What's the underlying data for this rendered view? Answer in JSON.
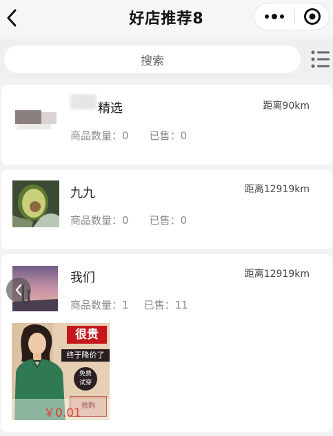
{
  "header": {
    "title": "好店推荐8"
  },
  "search": {
    "placeholder": "搜索"
  },
  "shops": [
    {
      "name": "精选",
      "distance": "距离90km",
      "goods_label": "商品数量：",
      "goods_count": "0",
      "sold_label": "已售：",
      "sold_count": "0"
    },
    {
      "name": "九九",
      "distance": "距离12919km",
      "goods_label": "商品数量：",
      "goods_count": "0",
      "sold_label": "已售：",
      "sold_count": "0"
    },
    {
      "name": "我们",
      "distance": "距离12919km",
      "goods_label": "商品数量：",
      "goods_count": "1",
      "sold_label": "已售：",
      "sold_count": "11"
    }
  ],
  "product": {
    "banner_text": "很贵",
    "subtitle": "终于降价了",
    "badge_line1": "免费",
    "badge_line2": "试穿",
    "price": "￥0.01",
    "buy_label": "抢购"
  },
  "colors": {
    "banner_red": "#c4161c",
    "price_red": "#e23b2e",
    "garment_green": "#2f7a52"
  },
  "icons": [
    "back-icon",
    "more-dots-icon",
    "mini-close-icon",
    "list-menu-icon",
    "chevron-left-icon"
  ]
}
